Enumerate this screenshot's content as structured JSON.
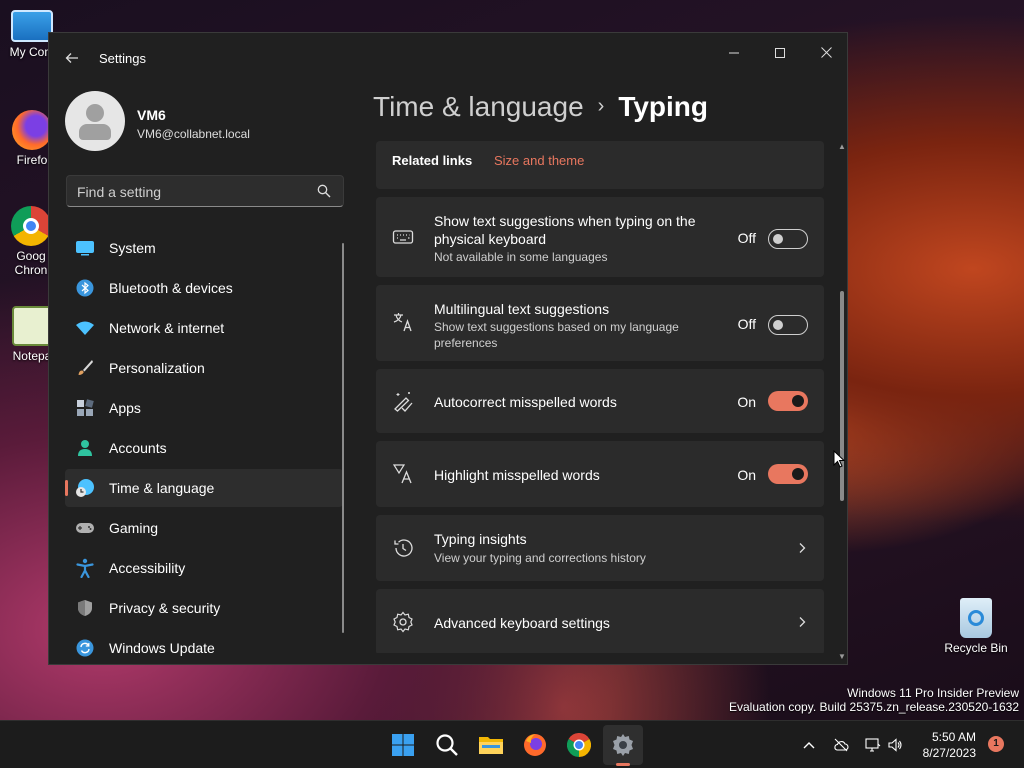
{
  "desktop": {
    "icons": [
      {
        "label": "My Com",
        "icon": "computer-icon"
      },
      {
        "label": "Firefo",
        "icon": "firefox-icon"
      },
      {
        "label": "Goog Chron",
        "icon": "chrome-icon"
      },
      {
        "label": "Notepa",
        "icon": "notepad-icon"
      },
      {
        "label": "Recycle Bin",
        "icon": "recycle-bin-icon"
      }
    ],
    "watermark": {
      "line1": "Windows 11 Pro Insider Preview",
      "line2": "Evaluation copy. Build 25375.zn_release.230520-1632"
    }
  },
  "window": {
    "title": "Settings",
    "controls": {
      "minimize": "—",
      "maximize": "☐",
      "close": "✕"
    }
  },
  "profile": {
    "name": "VM6",
    "email": "VM6@collabnet.local"
  },
  "search": {
    "placeholder": "Find a setting"
  },
  "sidebar": {
    "items": [
      {
        "label": "System",
        "icon": "system-icon",
        "color": "#4cc2ff"
      },
      {
        "label": "Bluetooth & devices",
        "icon": "bluetooth-icon",
        "color": "#3a96dd"
      },
      {
        "label": "Network & internet",
        "icon": "wifi-icon",
        "color": "#4cc2ff"
      },
      {
        "label": "Personalization",
        "icon": "brush-icon",
        "color": "#e0a060"
      },
      {
        "label": "Apps",
        "icon": "apps-icon",
        "color": "#9aa7b8"
      },
      {
        "label": "Accounts",
        "icon": "accounts-icon",
        "color": "#2fc4a0"
      },
      {
        "label": "Time & language",
        "icon": "clock-globe-icon",
        "color": "#4cc2ff",
        "active": true
      },
      {
        "label": "Gaming",
        "icon": "gamepad-icon",
        "color": "#b0b0b0"
      },
      {
        "label": "Accessibility",
        "icon": "accessibility-icon",
        "color": "#3a96dd"
      },
      {
        "label": "Privacy & security",
        "icon": "shield-icon",
        "color": "#8a8a8a"
      },
      {
        "label": "Windows Update",
        "icon": "windows-update-icon",
        "color": "#3a96dd"
      }
    ]
  },
  "breadcrumb": {
    "parent": "Time & language",
    "separator": "›",
    "current": "Typing"
  },
  "related": {
    "label": "Related links",
    "link": "Size and theme"
  },
  "settings": [
    {
      "title": "Show text suggestions when typing on the physical keyboard",
      "desc": "Not available in some languages",
      "state": "Off",
      "icon": "keyboard-icon"
    },
    {
      "title": "Multilingual text suggestions",
      "desc": "Show text suggestions based on my language preferences",
      "state": "Off",
      "icon": "multilingual-icon"
    },
    {
      "title": "Autocorrect misspelled words",
      "desc": "",
      "state": "On",
      "icon": "autocorrect-icon"
    },
    {
      "title": "Highlight misspelled words",
      "desc": "",
      "state": "On",
      "icon": "highlight-icon"
    },
    {
      "title": "Typing insights",
      "desc": "View your typing and corrections history",
      "icon": "history-icon"
    },
    {
      "title": "Advanced keyboard settings",
      "desc": "",
      "icon": "gear-icon"
    }
  ],
  "taskbar": {
    "apps": [
      "start-icon",
      "search-icon",
      "file-explorer-icon",
      "firefox-icon",
      "chrome-icon",
      "settings-icon"
    ],
    "clock": {
      "time": "5:50 AM",
      "date": "8/27/2023"
    },
    "notifications": "1",
    "accent": "#e8775f"
  }
}
